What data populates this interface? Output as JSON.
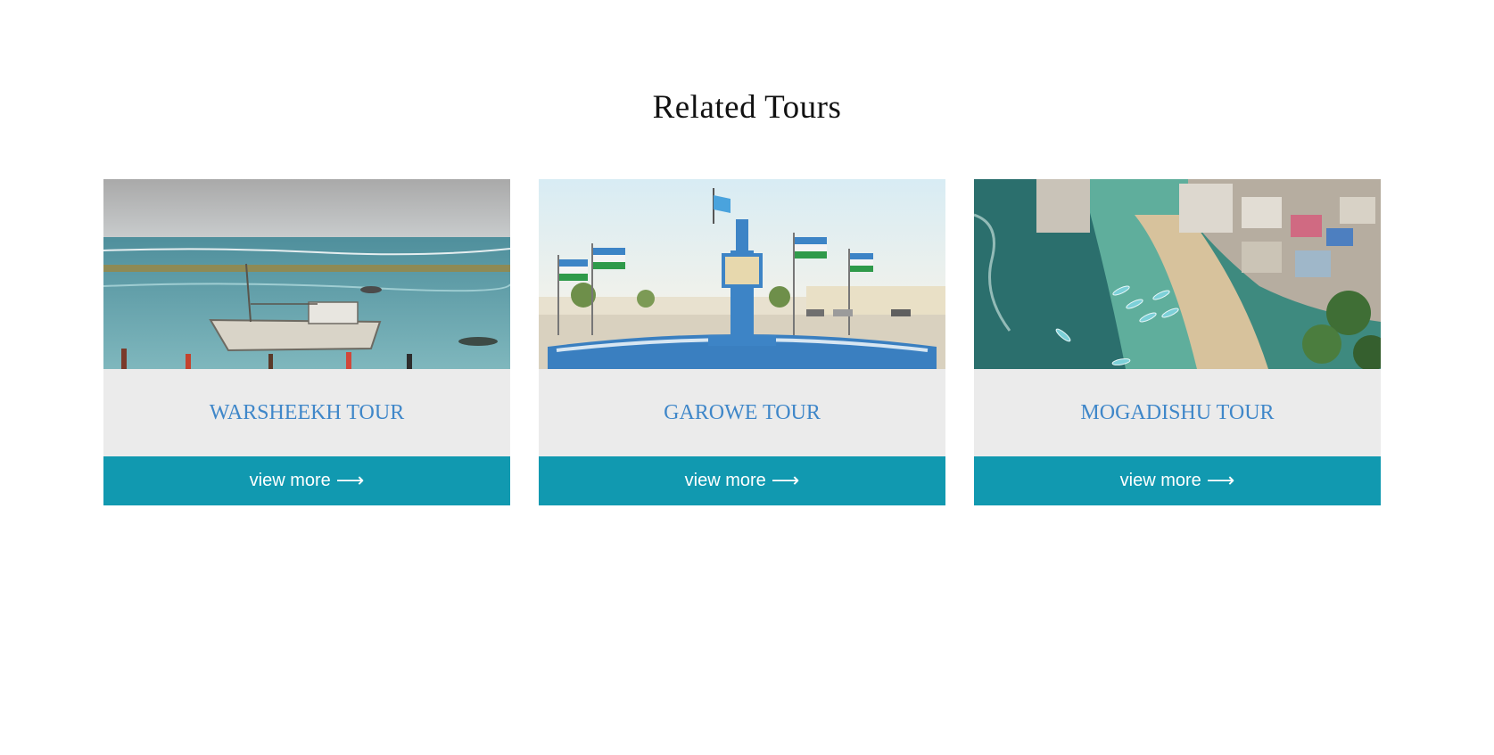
{
  "section": {
    "title": "Related Tours"
  },
  "colors": {
    "button_bg": "#1199b0",
    "title_link": "#3f87c9",
    "card_bg": "#ebebeb"
  },
  "tours": [
    {
      "title": "WARSHEEKH TOUR",
      "button_label": "view more",
      "button_icon": "arrow-right-icon",
      "image": "beach-with-fishing-boat"
    },
    {
      "title": "GAROWE TOUR",
      "button_label": "view more",
      "button_icon": "arrow-right-icon",
      "image": "monument-with-flags"
    },
    {
      "title": "MOGADISHU TOUR",
      "button_label": "view more",
      "button_icon": "arrow-right-icon",
      "image": "aerial-coastline-city"
    }
  ]
}
